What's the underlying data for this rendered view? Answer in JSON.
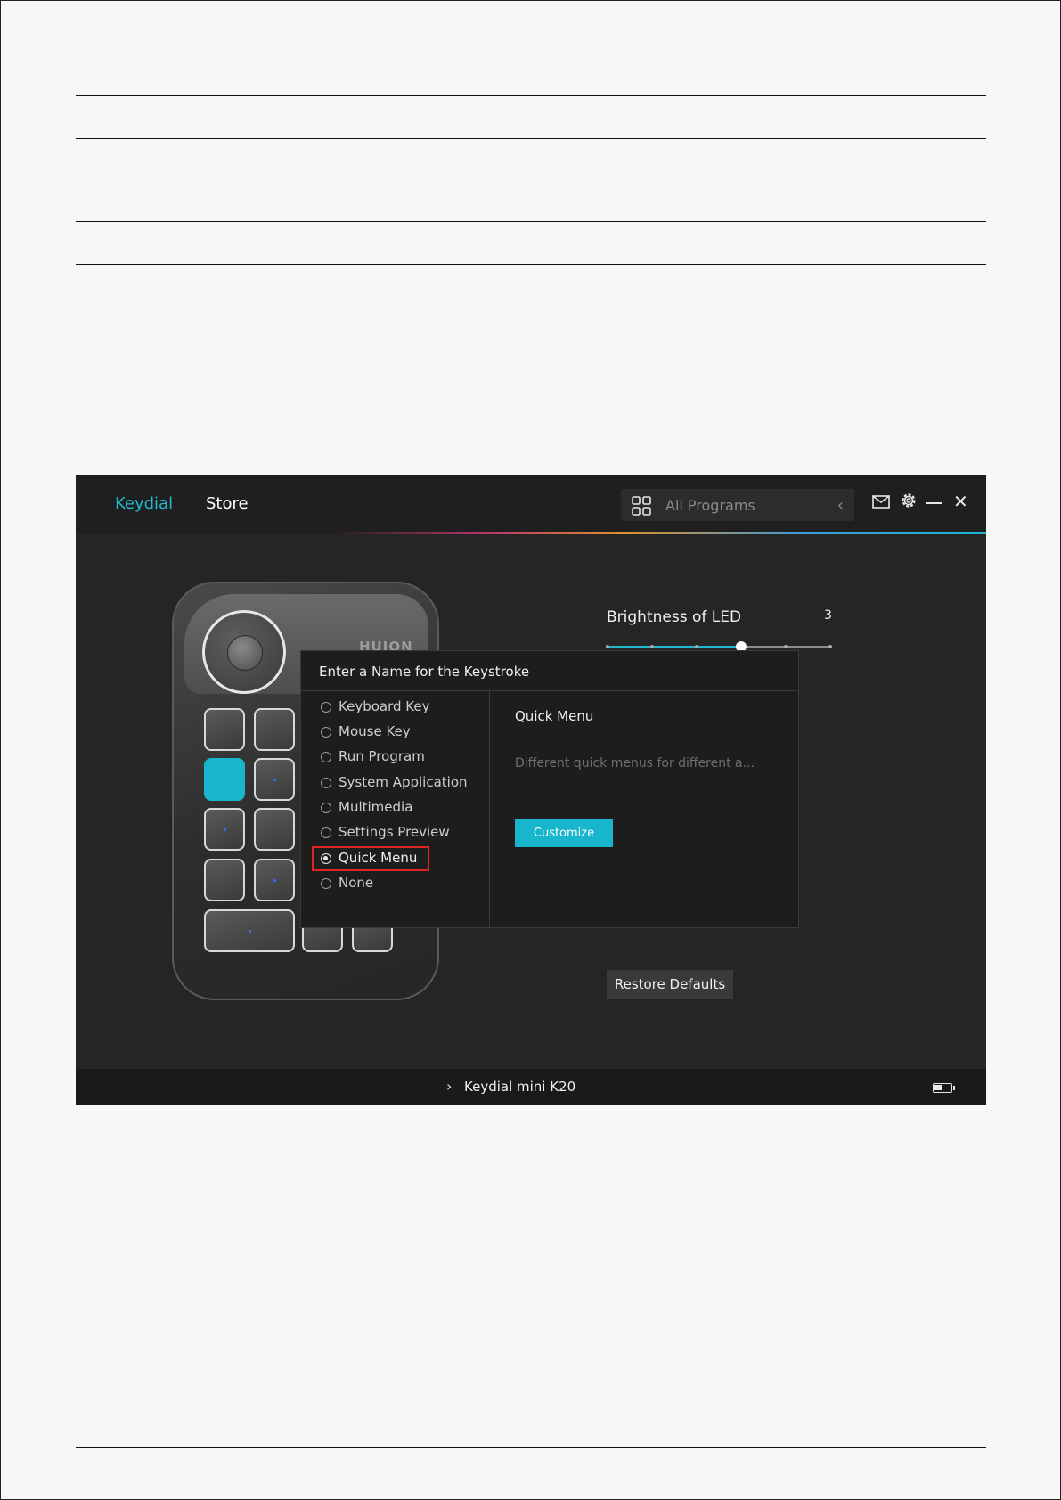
{
  "header": {
    "tabs": [
      {
        "label": "Keydial",
        "active": true
      },
      {
        "label": "Store",
        "active": false
      }
    ],
    "program_selector": {
      "label": "All Programs"
    }
  },
  "device": {
    "brand": "HUION"
  },
  "led": {
    "label": "Brightness of LED",
    "value": "3",
    "level": 3,
    "max": 5
  },
  "dialog": {
    "title": "Enter a Name for the Keystroke",
    "options": [
      {
        "label": "Keyboard Key"
      },
      {
        "label": "Mouse Key"
      },
      {
        "label": "Run Program"
      },
      {
        "label": "System Application"
      },
      {
        "label": "Multimedia"
      },
      {
        "label": "Settings Preview"
      },
      {
        "label": "Quick Menu",
        "selected": true
      },
      {
        "label": "None"
      }
    ],
    "detail_title": "Quick Menu",
    "detail_description": "Different quick menus for different a...",
    "customize_label": "Customize"
  },
  "restore_label": "Restore Defaults",
  "footer": {
    "device_name": "Keydial mini K20"
  },
  "colors": {
    "accent": "#17b6cc",
    "highlight": "#e02424"
  }
}
